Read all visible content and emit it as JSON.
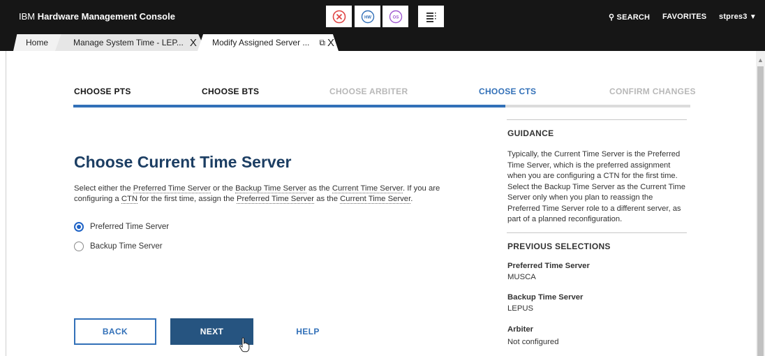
{
  "app": {
    "brand_prefix": "IBM",
    "brand_name": "Hardware Management Console"
  },
  "status_icons": [
    {
      "name": "error-status-icon",
      "color": "#e04545",
      "glyph": "⊗"
    },
    {
      "name": "hardware-status-icon",
      "color": "#3270b8",
      "glyph": "HW"
    },
    {
      "name": "os-status-icon",
      "color": "#a05ad0",
      "glyph": "OS"
    }
  ],
  "topbar": {
    "search_label": "SEARCH",
    "favorites_label": "FAVORITES",
    "user_label": "stpres3",
    "user_caret": "▼"
  },
  "tabs": {
    "home": "Home",
    "tab1": "Manage System Time - LEP...",
    "tab2": "Modify Assigned Server ...",
    "close_glyph": "X",
    "popout_glyph": "⧉"
  },
  "steps": [
    {
      "label": "CHOOSE PTS",
      "state": "done"
    },
    {
      "label": "CHOOSE BTS",
      "state": "done"
    },
    {
      "label": "CHOOSE ARBITER",
      "state": "todo"
    },
    {
      "label": "CHOOSE CTS",
      "state": "current"
    },
    {
      "label": "CONFIRM CHANGES",
      "state": "todo"
    }
  ],
  "progress_fraction": 0.7,
  "main": {
    "title": "Choose Current Time Server",
    "desc": {
      "p1": "Select either the ",
      "l1": "Preferred Time Server",
      "p2": " or the ",
      "l2": "Backup Time Server",
      "p3": " as the ",
      "l3": "Current Time Server",
      "p4": ". If you are configuring a ",
      "l4": "CTN",
      "p5": " for the first time, assign the ",
      "l5": "Preferred Time Server",
      "p6": " as the ",
      "l6": "Current Time Server",
      "p7": "."
    },
    "options": [
      {
        "label": "Preferred Time Server",
        "selected": true
      },
      {
        "label": "Backup Time Server",
        "selected": false
      }
    ],
    "back_label": "BACK",
    "next_label": "NEXT",
    "help_label": "HELP"
  },
  "guidance": {
    "heading": "GUIDANCE",
    "text": "Typically, the Current Time Server is the Preferred Time Server, which is the preferred assignment when you are configuring a CTN for the first time. Select the Backup Time Server as the Current Time Server only when you plan to reassign the Preferred Time Server role to a different server, as part of a planned reconfiguration."
  },
  "previous_selections": {
    "heading": "PREVIOUS SELECTIONS",
    "items": [
      {
        "label": "Preferred Time Server",
        "value": "MUSCA"
      },
      {
        "label": "Backup Time Server",
        "value": "LEPUS"
      },
      {
        "label": "Arbiter",
        "value": "Not configured"
      }
    ]
  },
  "colors": {
    "accent": "#3270b8",
    "primary_button": "#265480",
    "title": "#1c3e63",
    "topbar": "#161616"
  }
}
